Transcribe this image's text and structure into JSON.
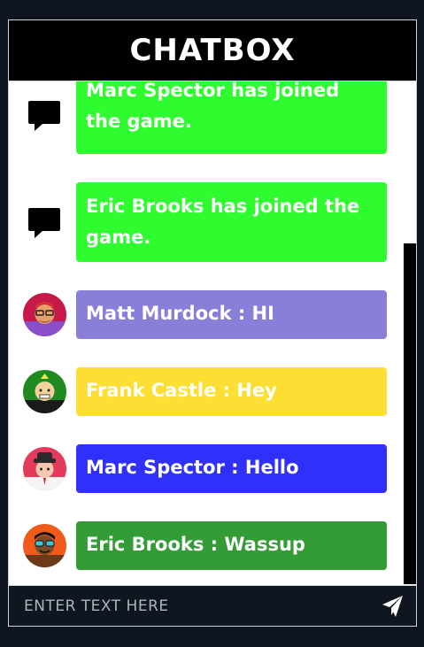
{
  "header": {
    "title": "CHATBOX"
  },
  "messages": [
    {
      "kind": "system",
      "text": "Marc Spector has joined the game.",
      "color": "#2efc2e",
      "icon": "speech-bubble-icon"
    },
    {
      "kind": "system",
      "text": "Eric Brooks has joined the game.",
      "color": "#2efc2e",
      "icon": "speech-bubble-icon"
    },
    {
      "kind": "chat",
      "user": "Matt Murdock",
      "text": "Matt Murdock : HI",
      "color": "#8a7fd8",
      "avatar_bg": "#c6194a"
    },
    {
      "kind": "chat",
      "user": "Frank Castle",
      "text": "Frank Castle : Hey",
      "color": "#fdde32",
      "avatar_bg": "#1f8a1f"
    },
    {
      "kind": "chat",
      "user": "Marc Spector",
      "text": "Marc Spector : Hello",
      "color": "#3030fa",
      "avatar_bg": "#e43a5c"
    },
    {
      "kind": "chat",
      "user": "Eric Brooks",
      "text": "Eric Brooks : Wassup",
      "color": "#339c36",
      "avatar_bg": "#f25a1c"
    }
  ],
  "footer": {
    "placeholder": "ENTER TEXT HERE",
    "send_icon": "paper-plane-icon"
  }
}
